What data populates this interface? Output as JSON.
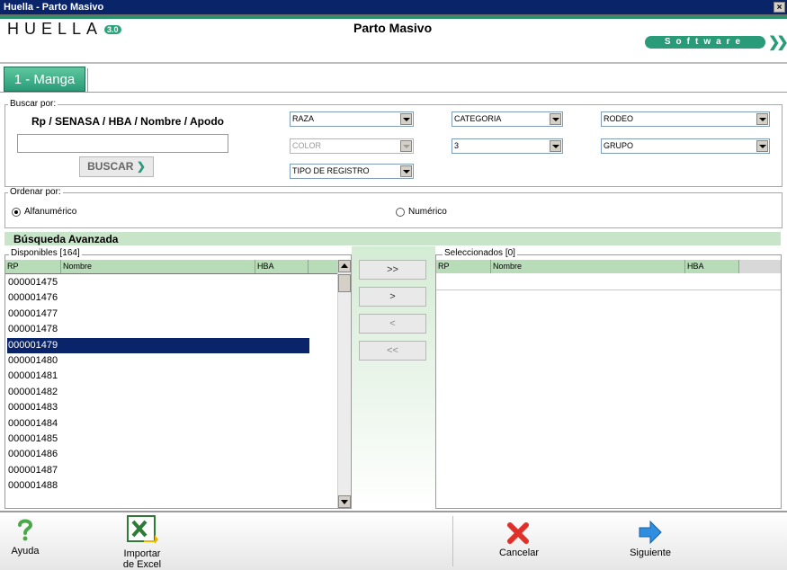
{
  "window": {
    "title": "Huella - Parto Masivo",
    "close_glyph": "×"
  },
  "header": {
    "logo_text": "HUELLA",
    "logo_version": "3.0",
    "title": "Parto Masivo",
    "software_badge": "Software",
    "chevrons": "❯❯"
  },
  "tabs": [
    {
      "label": "1 - Manga",
      "active": true
    }
  ],
  "buscar": {
    "legend": "Buscar por:",
    "heading": "Rp / SENASA / HBA / Nombre / Apodo",
    "input_value": "",
    "button_label": "BUSCAR",
    "button_glyph": "❯"
  },
  "filters": {
    "raza": "RAZA",
    "color": "COLOR",
    "tipo_registro": "TIPO DE REGISTRO",
    "categoria": "CATEGORIA",
    "numero": "3",
    "rodeo": "RODEO",
    "grupo": "GRUPO"
  },
  "ordenar": {
    "legend": "Ordenar por:",
    "options": [
      {
        "label": "Alfanumérico",
        "checked": true
      },
      {
        "label": "Numérico",
        "checked": false
      }
    ]
  },
  "busqueda_avanzada": {
    "label": "Búsqueda Avanzada"
  },
  "disponibles": {
    "legend": "Disponibles [164]",
    "columns": [
      "RP",
      "Nombre",
      "HBA"
    ],
    "rows": [
      "000001475",
      "000001476",
      "000001477",
      "000001478",
      "000001479",
      "000001480",
      "000001481",
      "000001482",
      "000001483",
      "000001484",
      "000001485",
      "000001486",
      "000001487",
      "000001488"
    ],
    "selected_index": 4
  },
  "transfer_buttons": [
    ">>",
    ">",
    "<",
    "<<"
  ],
  "seleccionados": {
    "legend": "Seleccionados [0]",
    "columns": [
      "RP",
      "Nombre",
      "HBA"
    ]
  },
  "footer": {
    "ayuda": "Ayuda",
    "importar_line1": "Importar",
    "importar_line2": "de Excel",
    "cancelar": "Cancelar",
    "siguiente": "Siguiente"
  },
  "colors": {
    "accent": "#2a9b78",
    "title_bar": "#0a246a",
    "grid_header": "#b8dcb8",
    "selection": "#0a246a"
  }
}
